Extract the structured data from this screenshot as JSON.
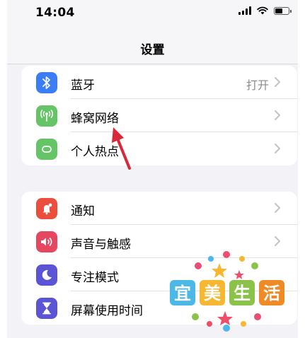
{
  "status_bar": {
    "time": "14:04"
  },
  "nav": {
    "title": "设置"
  },
  "group1": [
    {
      "label": "蓝牙",
      "value": "打开",
      "icon": "bluetooth-icon",
      "color": "#3a7df5"
    },
    {
      "label": "蜂窝网络",
      "value": "",
      "icon": "cellular-icon",
      "color": "#65c466"
    },
    {
      "label": "个人热点",
      "value": "",
      "icon": "hotspot-icon",
      "color": "#65c466"
    }
  ],
  "group2": [
    {
      "label": "通知",
      "icon": "notification-icon",
      "color": "#eb4e3d"
    },
    {
      "label": "声音与触感",
      "icon": "sound-icon",
      "color": "#e64760"
    },
    {
      "label": "专注模式",
      "icon": "moon-icon",
      "color": "#5b54d5"
    },
    {
      "label": "屏幕使用时间",
      "icon": "hourglass-icon",
      "color": "#5b54d5"
    }
  ],
  "watermark": {
    "text": [
      "宜",
      "美",
      "生",
      "活"
    ]
  },
  "colors": {
    "arrow": "#d9283a"
  }
}
